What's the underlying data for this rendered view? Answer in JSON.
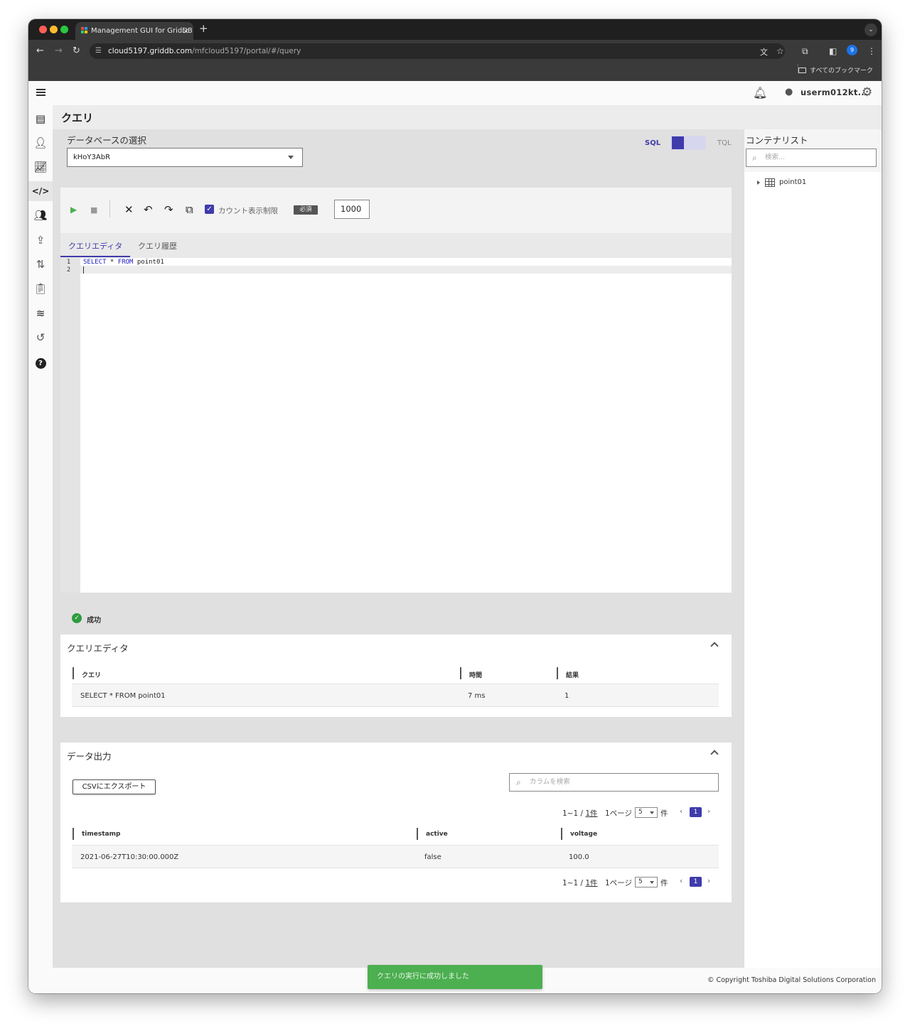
{
  "browser": {
    "tab_title": "Management GUI for GridDB",
    "tab_close": "×",
    "new_tab": "+",
    "url_host": "cloud5197.griddb.com",
    "url_path": "/mfcloud5197/portal/#/query",
    "profile_badge": "9",
    "bookmarks_label": "すべてのブックマーク",
    "traffic_colors": [
      "#ff5f57",
      "#febc2e",
      "#28c840"
    ]
  },
  "header": {
    "username": "userm012kt..."
  },
  "sidebar": {
    "items": [
      {
        "icon": "database-icon"
      },
      {
        "icon": "users-settings-icon"
      },
      {
        "icon": "chart-icon"
      },
      {
        "icon": "code-icon"
      },
      {
        "icon": "group-icon"
      },
      {
        "icon": "upload-icon"
      },
      {
        "icon": "import-icon"
      },
      {
        "icon": "clipboard-icon"
      },
      {
        "icon": "routes-icon"
      },
      {
        "icon": "history-icon"
      },
      {
        "icon": "help-icon"
      }
    ]
  },
  "page": {
    "title": "クエリ"
  },
  "db": {
    "label": "データベースの選択",
    "selected": "kHoY3AbR"
  },
  "mode": {
    "sql": "SQL",
    "tql": "TQL",
    "active": "SQL"
  },
  "editor": {
    "count_label": "カウント表示制限",
    "count_checked": true,
    "required_badge": "必須",
    "limit_value": "1000",
    "tabs": [
      "クエリエディタ",
      "クエリ履歴"
    ],
    "active_tab": 0,
    "lines": [
      {
        "num": "1",
        "kw1": "SELECT",
        "mid": " * ",
        "kw2": "FROM",
        "rest": " point01"
      },
      {
        "num": "2"
      }
    ]
  },
  "status": {
    "success_label": "成功"
  },
  "query_results": {
    "title": "クエリエディタ",
    "columns": [
      "クエリ",
      "時間",
      "結果"
    ],
    "rows": [
      {
        "query": "SELECT * FROM point01",
        "time": "7 ms",
        "result": "1"
      }
    ]
  },
  "data_output": {
    "title": "データ出力",
    "export_button": "CSVにエクスポート",
    "search_placeholder": "カラムを検索",
    "pager": {
      "count_prefix": "1~1 / ",
      "count_total": "1件",
      "per_page_label": "1ページ",
      "per_page": "5",
      "unit": "件",
      "current_page": "1"
    },
    "columns": [
      "timestamp",
      "active",
      "voltage"
    ],
    "rows": [
      {
        "timestamp": "2021-06-27T10:30:00.000Z",
        "active": "false",
        "voltage": "100.0"
      }
    ]
  },
  "container_list": {
    "title": "コンテナリスト",
    "search_placeholder": "検索...",
    "items": [
      "point01"
    ]
  },
  "footer": {
    "copyright": "© Copyright Toshiba Digital Solutions Corporation"
  },
  "snackbar": {
    "message": "クエリの実行に成功しました"
  },
  "colors": {
    "accent": "#3f3bab",
    "success": "#4caf50"
  }
}
